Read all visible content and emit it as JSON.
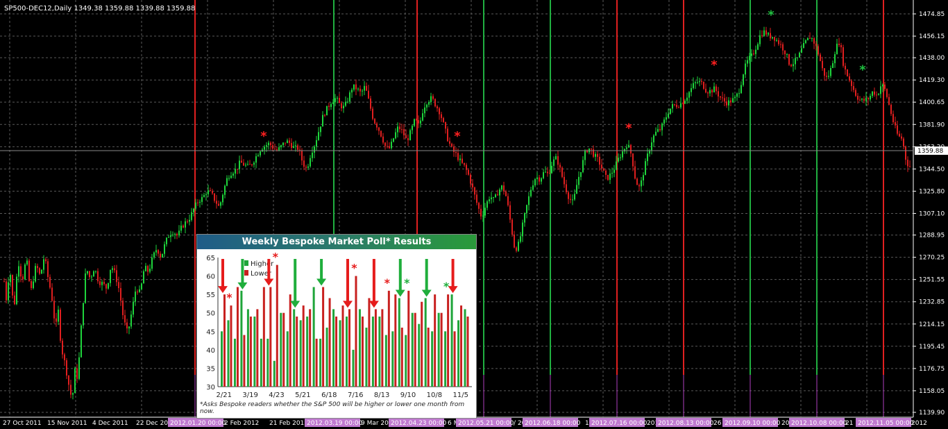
{
  "instrument_label": "SP500-DEC12,Daily  1349.38 1359.88 1339.88 1359.88",
  "current_price_label": "1359.88",
  "chart_data": [
    {
      "type": "candlestick",
      "price_axis_ticks": [
        "1474.85",
        "1456.15",
        "1438.00",
        "1419.30",
        "1400.65",
        "1381.90",
        "1363.20",
        "1344.50",
        "1325.80",
        "1307.10",
        "1288.95",
        "1270.25",
        "1251.55",
        "1232.85",
        "1214.15",
        "1195.45",
        "1176.75",
        "1158.05",
        "1139.90"
      ],
      "ylim": [
        1139.9,
        1474.85
      ],
      "time_axis_labels": [
        "27 Oct 2011",
        "15 Nov 2011",
        "4 Dec 2011",
        "22 Dec 20",
        "2 Feb 2012",
        "21 Feb 2012",
        "9 Mar 201",
        "6 M",
        "/ 20",
        "1 J",
        "201",
        "26",
        "20",
        "21",
        "2012"
      ],
      "event_markers": [
        {
          "label": "2012.01.20 00:00",
          "color": "red"
        },
        {
          "label": "2012.03.19 00:00",
          "color": "green"
        },
        {
          "label": "2012.04.23 00:00",
          "color": "red"
        },
        {
          "label": "2012.05.21 00:00",
          "color": "green"
        },
        {
          "label": "2012.06.18 00:00",
          "color": "green"
        },
        {
          "label": "2012.07.16 00:00",
          "color": "red"
        },
        {
          "label": "2012.08.13 00:00",
          "color": "red"
        },
        {
          "label": "2012.09.10 00:00",
          "color": "green"
        },
        {
          "label": "2012.10.08 00:00",
          "color": "green"
        },
        {
          "label": "2012.11.05 00:00",
          "color": "red"
        }
      ],
      "asterisks": [
        {
          "color": "red",
          "price": 1365
        },
        {
          "color": "red",
          "price": 1365
        },
        {
          "color": "red",
          "price": 1372
        },
        {
          "color": "red",
          "price": 1425
        },
        {
          "color": "green",
          "price": 1467
        },
        {
          "color": "green",
          "price": 1421
        }
      ],
      "path_anchors": [
        [
          0,
          1288
        ],
        [
          4,
          1270
        ],
        [
          8,
          1230
        ],
        [
          14,
          1262
        ],
        [
          20,
          1225
        ],
        [
          26,
          1268
        ],
        [
          32,
          1250
        ],
        [
          38,
          1270
        ],
        [
          44,
          1240
        ],
        [
          52,
          1264
        ],
        [
          58,
          1254
        ],
        [
          64,
          1272
        ],
        [
          70,
          1250
        ],
        [
          74,
          1240
        ],
        [
          80,
          1210
        ],
        [
          84,
          1225
        ],
        [
          88,
          1195
        ],
        [
          94,
          1180
        ],
        [
          100,
          1160
        ],
        [
          104,
          1150
        ],
        [
          108,
          1175
        ],
        [
          112,
          1168
        ],
        [
          118,
          1220
        ],
        [
          124,
          1262
        ],
        [
          130,
          1252
        ],
        [
          136,
          1262
        ],
        [
          142,
          1250
        ],
        [
          148,
          1248
        ],
        [
          154,
          1244
        ],
        [
          160,
          1264
        ],
        [
          166,
          1256
        ],
        [
          172,
          1242
        ],
        [
          178,
          1218
        ],
        [
          184,
          1206
        ],
        [
          190,
          1225
        ],
        [
          196,
          1245
        ],
        [
          202,
          1240
        ],
        [
          208,
          1262
        ],
        [
          214,
          1258
        ],
        [
          220,
          1270
        ],
        [
          226,
          1278
        ],
        [
          232,
          1270
        ],
        [
          238,
          1282
        ],
        [
          244,
          1290
        ],
        [
          250,
          1292
        ],
        [
          256,
          1288
        ],
        [
          262,
          1296
        ],
        [
          268,
          1300
        ],
        [
          274,
          1304
        ],
        [
          280,
          1312
        ],
        [
          286,
          1318
        ],
        [
          292,
          1320
        ],
        [
          298,
          1326
        ],
        [
          304,
          1324
        ],
        [
          310,
          1318
        ],
        [
          316,
          1312
        ],
        [
          322,
          1326
        ],
        [
          328,
          1338
        ],
        [
          334,
          1342
        ],
        [
          340,
          1344
        ],
        [
          346,
          1350
        ],
        [
          352,
          1348
        ],
        [
          358,
          1346
        ],
        [
          364,
          1350
        ],
        [
          370,
          1356
        ],
        [
          376,
          1362
        ],
        [
          382,
          1364
        ],
        [
          388,
          1366
        ],
        [
          394,
          1362
        ],
        [
          400,
          1360
        ],
        [
          406,
          1364
        ],
        [
          412,
          1368
        ],
        [
          418,
          1366
        ],
        [
          424,
          1362
        ],
        [
          430,
          1362
        ],
        [
          436,
          1350
        ],
        [
          442,
          1344
        ],
        [
          448,
          1358
        ],
        [
          454,
          1366
        ],
        [
          460,
          1378
        ],
        [
          466,
          1390
        ],
        [
          472,
          1396
        ],
        [
          478,
          1402
        ],
        [
          484,
          1404
        ],
        [
          490,
          1398
        ],
        [
          496,
          1396
        ],
        [
          502,
          1404
        ],
        [
          508,
          1414
        ],
        [
          514,
          1412
        ],
        [
          520,
          1408
        ],
        [
          526,
          1414
        ],
        [
          532,
          1400
        ],
        [
          538,
          1386
        ],
        [
          544,
          1380
        ],
        [
          550,
          1372
        ],
        [
          556,
          1362
        ],
        [
          562,
          1362
        ],
        [
          568,
          1372
        ],
        [
          574,
          1380
        ],
        [
          580,
          1376
        ],
        [
          586,
          1368
        ],
        [
          592,
          1376
        ],
        [
          598,
          1386
        ],
        [
          604,
          1380
        ],
        [
          610,
          1396
        ],
        [
          616,
          1402
        ],
        [
          622,
          1404
        ],
        [
          628,
          1398
        ],
        [
          634,
          1392
        ],
        [
          640,
          1380
        ],
        [
          646,
          1368
        ],
        [
          652,
          1360
        ],
        [
          658,
          1356
        ],
        [
          664,
          1350
        ],
        [
          670,
          1346
        ],
        [
          676,
          1338
        ],
        [
          682,
          1326
        ],
        [
          688,
          1314
        ],
        [
          694,
          1304
        ],
        [
          700,
          1314
        ],
        [
          706,
          1322
        ],
        [
          712,
          1318
        ],
        [
          718,
          1326
        ],
        [
          724,
          1330
        ],
        [
          730,
          1320
        ],
        [
          736,
          1298
        ],
        [
          742,
          1276
        ],
        [
          748,
          1282
        ],
        [
          754,
          1300
        ],
        [
          760,
          1316
        ],
        [
          766,
          1330
        ],
        [
          772,
          1338
        ],
        [
          778,
          1336
        ],
        [
          784,
          1342
        ],
        [
          790,
          1340
        ],
        [
          796,
          1350
        ],
        [
          802,
          1354
        ],
        [
          808,
          1342
        ],
        [
          814,
          1330
        ],
        [
          820,
          1320
        ],
        [
          826,
          1316
        ],
        [
          832,
          1334
        ],
        [
          838,
          1346
        ],
        [
          844,
          1360
        ],
        [
          850,
          1362
        ],
        [
          856,
          1356
        ],
        [
          862,
          1352
        ],
        [
          868,
          1344
        ],
        [
          874,
          1336
        ],
        [
          880,
          1340
        ],
        [
          886,
          1346
        ],
        [
          892,
          1354
        ],
        [
          898,
          1360
        ],
        [
          904,
          1366
        ],
        [
          910,
          1356
        ],
        [
          916,
          1334
        ],
        [
          922,
          1328
        ],
        [
          928,
          1344
        ],
        [
          934,
          1358
        ],
        [
          940,
          1370
        ],
        [
          946,
          1376
        ],
        [
          952,
          1378
        ],
        [
          958,
          1386
        ],
        [
          964,
          1394
        ],
        [
          970,
          1398
        ],
        [
          976,
          1398
        ],
        [
          982,
          1400
        ],
        [
          988,
          1404
        ],
        [
          994,
          1410
        ],
        [
          1000,
          1416
        ],
        [
          1006,
          1418
        ],
        [
          1012,
          1416
        ],
        [
          1018,
          1410
        ],
        [
          1024,
          1410
        ],
        [
          1030,
          1412
        ],
        [
          1036,
          1406
        ],
        [
          1042,
          1402
        ],
        [
          1048,
          1400
        ],
        [
          1054,
          1402
        ],
        [
          1060,
          1404
        ],
        [
          1066,
          1412
        ],
        [
          1072,
          1428
        ],
        [
          1078,
          1436
        ],
        [
          1084,
          1440
        ],
        [
          1090,
          1448
        ],
        [
          1096,
          1458
        ],
        [
          1102,
          1460
        ],
        [
          1108,
          1456
        ],
        [
          1114,
          1456
        ],
        [
          1120,
          1452
        ],
        [
          1126,
          1448
        ],
        [
          1132,
          1442
        ],
        [
          1138,
          1432
        ],
        [
          1144,
          1434
        ],
        [
          1150,
          1438
        ],
        [
          1156,
          1446
        ],
        [
          1162,
          1452
        ],
        [
          1168,
          1456
        ],
        [
          1174,
          1450
        ],
        [
          1180,
          1440
        ],
        [
          1186,
          1426
        ],
        [
          1192,
          1420
        ],
        [
          1198,
          1430
        ],
        [
          1204,
          1446
        ],
        [
          1210,
          1452
        ],
        [
          1216,
          1430
        ],
        [
          1222,
          1422
        ],
        [
          1228,
          1414
        ],
        [
          1234,
          1406
        ],
        [
          1240,
          1402
        ],
        [
          1246,
          1402
        ],
        [
          1252,
          1404
        ],
        [
          1258,
          1410
        ],
        [
          1264,
          1406
        ],
        [
          1270,
          1416
        ],
        [
          1276,
          1410
        ],
        [
          1282,
          1396
        ],
        [
          1288,
          1382
        ],
        [
          1294,
          1372
        ],
        [
          1300,
          1370
        ],
        [
          1306,
          1350
        ],
        [
          1312,
          1346
        ],
        [
          1316,
          1360
        ]
      ]
    },
    {
      "type": "bar",
      "title": "Weekly Bespoke Market Poll* Results",
      "legend": [
        "Higher",
        "Lower"
      ],
      "ylim": [
        30,
        65
      ],
      "y_ticks": [
        "65",
        "60",
        "55",
        "50",
        "45",
        "40",
        "35",
        "30"
      ],
      "x_tick_labels": [
        "2/21",
        "3/19",
        "4/23",
        "5/21",
        "6/18",
        "7/16",
        "8/13",
        "9/10",
        "10/8",
        "11/5"
      ],
      "series": [
        {
          "name": "Higher",
          "values": [
            45,
            48,
            43,
            56,
            51,
            49,
            43,
            43,
            37,
            50,
            45,
            51,
            48,
            49,
            57,
            43,
            46,
            51,
            48,
            49,
            40,
            51,
            46,
            49,
            49,
            44,
            45,
            54,
            44,
            50,
            47,
            54,
            45,
            50,
            45,
            55,
            48,
            51
          ]
        },
        {
          "name": "Lower",
          "values": [
            55,
            52,
            57,
            44,
            49,
            51,
            57,
            57,
            63,
            50,
            55,
            49,
            52,
            51,
            43,
            57,
            54,
            49,
            52,
            51,
            60,
            49,
            54,
            51,
            51,
            56,
            55,
            46,
            56,
            50,
            53,
            46,
            55,
            50,
            55,
            45,
            52,
            49
          ]
        }
      ],
      "arrows": [
        {
          "bar": 0,
          "color": "red",
          "dir": "down"
        },
        {
          "bar": 3,
          "color": "green",
          "dir": "down"
        },
        {
          "bar": 7,
          "color": "red",
          "dir": "down"
        },
        {
          "bar": 11,
          "color": "green",
          "dir": "down"
        },
        {
          "bar": 15,
          "color": "green",
          "dir": "down"
        },
        {
          "bar": 19,
          "color": "red",
          "dir": "down"
        },
        {
          "bar": 23,
          "color": "red",
          "dir": "down"
        },
        {
          "bar": 27,
          "color": "green",
          "dir": "down"
        },
        {
          "bar": 31,
          "color": "green",
          "dir": "down"
        },
        {
          "bar": 35,
          "color": "red",
          "dir": "down"
        }
      ],
      "asterisks": [
        {
          "bar": 1,
          "color": "red"
        },
        {
          "bar": 8,
          "color": "red"
        },
        {
          "bar": 20,
          "color": "red"
        },
        {
          "bar": 25,
          "color": "red"
        },
        {
          "bar": 28,
          "color": "green"
        },
        {
          "bar": 34,
          "color": "green"
        }
      ],
      "footnote": "*Asks Bespoke readers whether the S&P 500 will be higher or lower one month from now."
    }
  ]
}
